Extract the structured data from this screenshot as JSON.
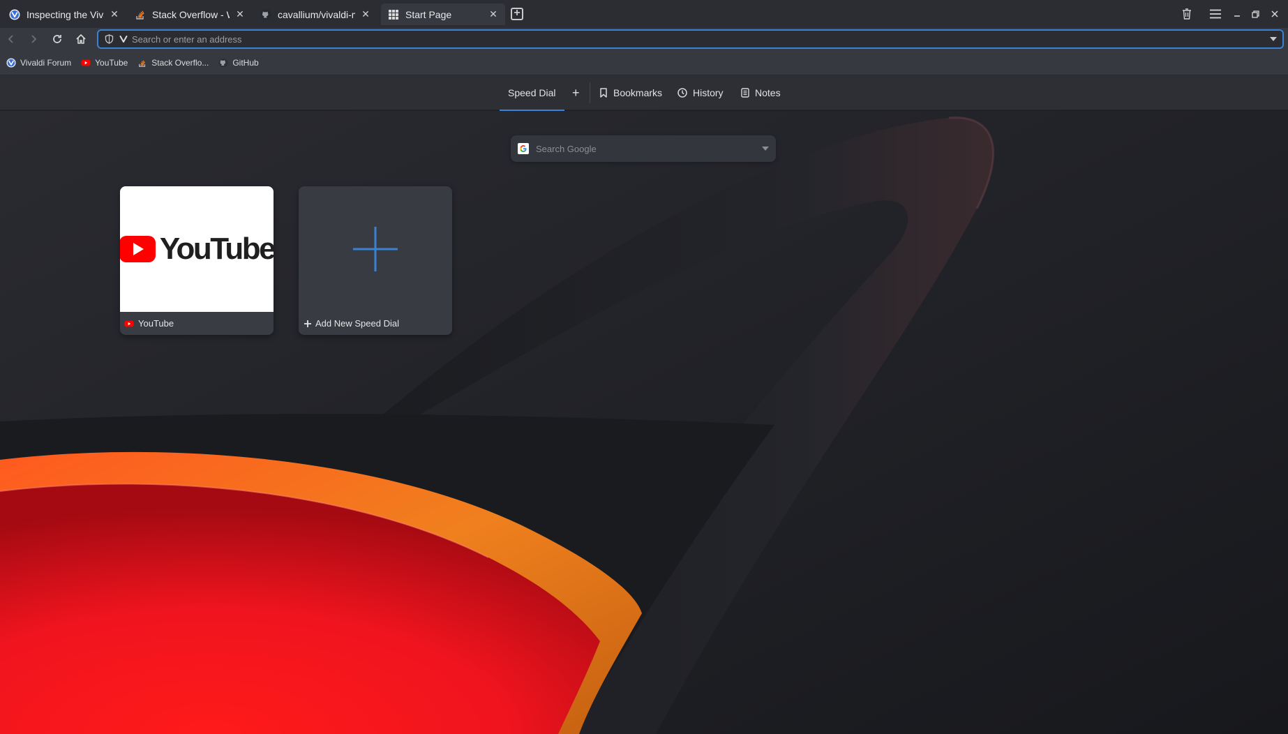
{
  "tabs": [
    {
      "title": "Inspecting the Vivaldi",
      "icon": "vivaldi-icon",
      "active": false
    },
    {
      "title": "Stack Overflow - When",
      "icon": "stackoverflow-icon",
      "active": false
    },
    {
      "title": "cavallium/vivaldi-mod",
      "icon": "github-icon",
      "active": false
    },
    {
      "title": "Start Page",
      "icon": "grid-icon",
      "active": true
    }
  ],
  "tab_close_glyph": "✕",
  "window_controls": [
    "trash-icon",
    "menu-icon",
    "minimize-icon",
    "restore-icon",
    "close-icon"
  ],
  "navbar": {
    "address_placeholder": "Search or enter an address",
    "address_value": ""
  },
  "bookmarks": [
    {
      "label": "Vivaldi Forum",
      "icon": "vivaldi-icon"
    },
    {
      "label": "YouTube",
      "icon": "youtube-icon"
    },
    {
      "label": "Stack Overflo...",
      "icon": "stackoverflow-icon"
    },
    {
      "label": "GitHub",
      "icon": "github-icon"
    }
  ],
  "startpage": {
    "tabs": {
      "speed_dial": "Speed Dial",
      "add": "+",
      "bookmarks": "Bookmarks",
      "history": "History",
      "notes": "Notes"
    },
    "search_placeholder": "Search Google",
    "search_engine_icon": "google-icon",
    "dials": [
      {
        "title": "YouTube",
        "thumbnail_text": "YouTube",
        "icon": "youtube-icon"
      },
      {
        "title": "Add New Speed Dial",
        "icon": "plus-icon"
      }
    ]
  },
  "colors": {
    "accent": "#3b82d6",
    "tab_bar": "#2b2d33",
    "toolbar": "#363940",
    "youtube_red": "#ff0000"
  }
}
